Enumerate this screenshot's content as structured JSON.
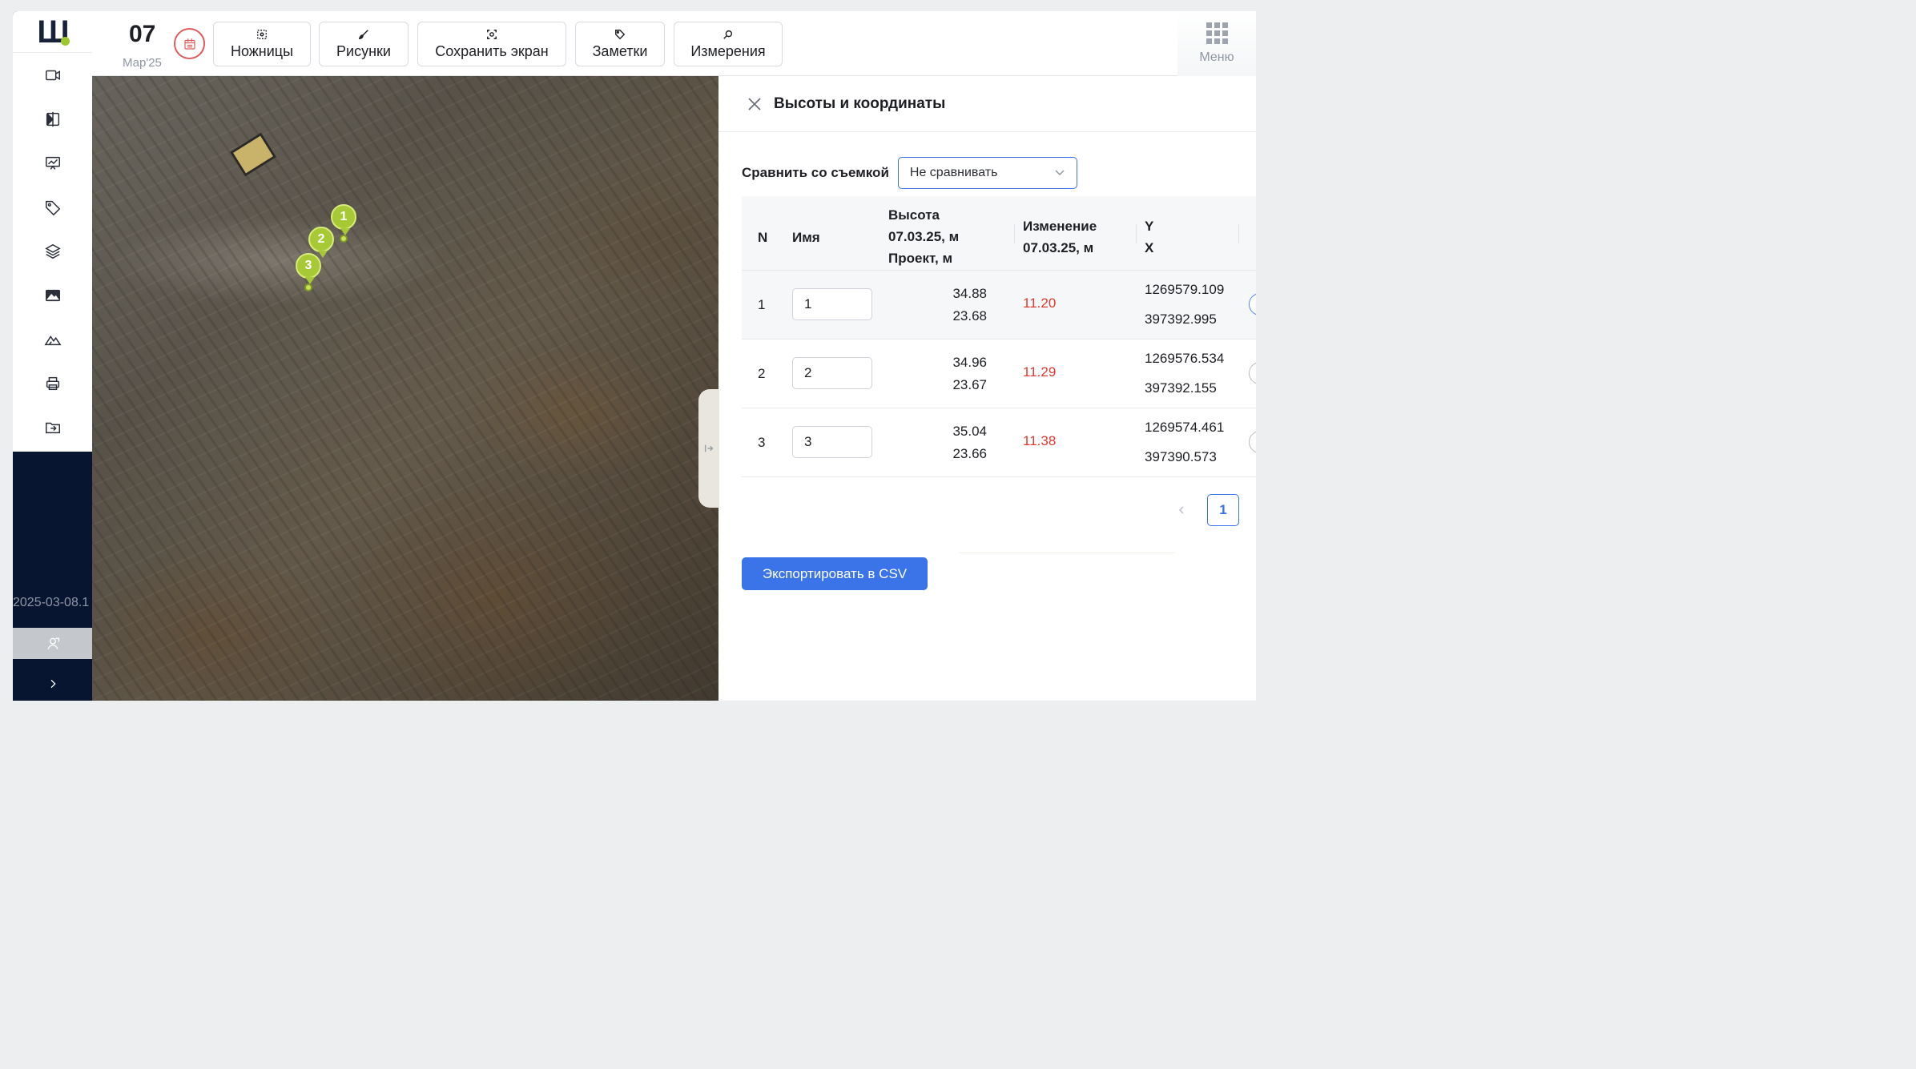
{
  "topbar": {
    "day": "07",
    "month_year": "Мар'25",
    "tools": [
      {
        "label": "Ножницы",
        "icon": "scissors-icon"
      },
      {
        "label": "Рисунки",
        "icon": "brush-icon"
      },
      {
        "label": "Сохранить экран",
        "icon": "screenshot-icon"
      },
      {
        "label": "Заметки",
        "icon": "tag-icon"
      },
      {
        "label": "Измерения",
        "icon": "measure-icon"
      }
    ],
    "menu_label": "Меню"
  },
  "sidebar": {
    "logo": "Ш",
    "tools": [
      {
        "icon": "video-icon"
      },
      {
        "icon": "compare-icon"
      },
      {
        "icon": "presentation-icon"
      },
      {
        "icon": "tag-icon"
      },
      {
        "icon": "layers-icon"
      },
      {
        "icon": "image-icon"
      },
      {
        "icon": "terrain-icon"
      },
      {
        "icon": "print-icon"
      },
      {
        "icon": "import-icon"
      }
    ],
    "date_label": "2025-03-08.1"
  },
  "map": {
    "markers": [
      "1",
      "2",
      "3"
    ]
  },
  "panel": {
    "title": "Высоты и координаты",
    "compare_label": "Сравнить со съемкой",
    "compare_value": "Не сравнивать",
    "columns": {
      "n": "N",
      "name": "Имя",
      "height_line1": "Высота",
      "height_line2": "07.03.25, м",
      "height_line3": "Проект, м",
      "change_line1": "Изменение",
      "change_line2": "07.03.25, м",
      "y": "Y",
      "x": "X"
    },
    "rows": [
      {
        "n": "1",
        "name": "1",
        "height": "34.88",
        "project": "23.68",
        "change": "11.20",
        "y": "1269579.109",
        "x": "397392.995"
      },
      {
        "n": "2",
        "name": "2",
        "height": "34.96",
        "project": "23.67",
        "change": "11.29",
        "y": "1269576.534",
        "x": "397392.155"
      },
      {
        "n": "3",
        "name": "3",
        "height": "35.04",
        "project": "23.66",
        "change": "11.38",
        "y": "1269574.461",
        "x": "397390.573"
      }
    ],
    "current_page": "1",
    "export_label": "Экспортировать в CSV"
  },
  "colors": {
    "accent": "#3b74e8",
    "change_text": "#e0382f",
    "marker": "#a7c936",
    "sidebar_dark": "#071530"
  }
}
